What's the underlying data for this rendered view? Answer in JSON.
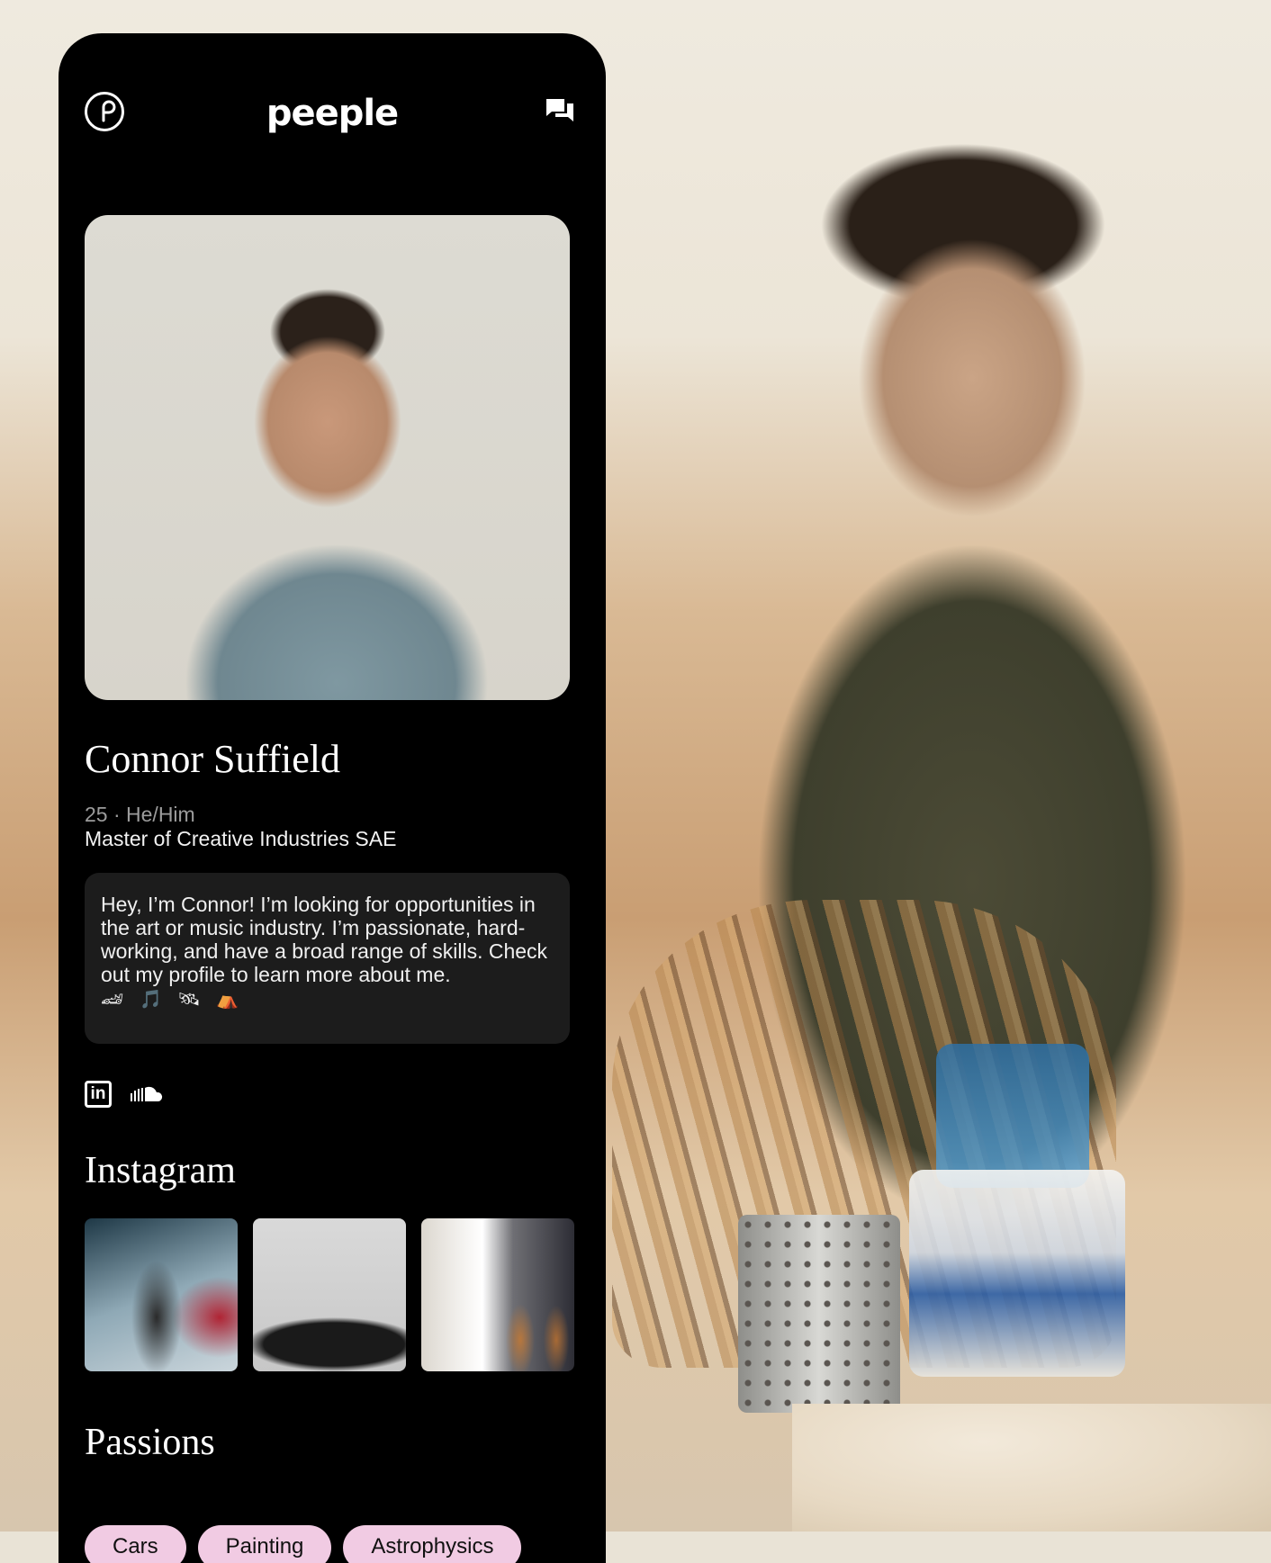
{
  "app": {
    "brand": "peeple"
  },
  "profile": {
    "name": "Connor Suffield",
    "age_pronouns": "25 · He/Him",
    "education": "Master of Creative Industries SAE",
    "bio": "Hey, I’m Connor! I’m looking for opportunities in the art or music industry. I’m passionate, hard-working, and have a broad range of skills. Check out my profile to learn more about me.",
    "bio_emojis": "🏎 🎵 🛰 ⛺",
    "socials": [
      {
        "icon": "linkedin-icon",
        "label": "in"
      },
      {
        "icon": "soundcloud-icon"
      }
    ]
  },
  "instagram": {
    "title": "Instagram",
    "photos": [
      "concert-photo",
      "record-player-photo",
      "guitar-room-photo"
    ]
  },
  "passions": {
    "title": "Passions",
    "items": [
      "Cars",
      "Painting",
      "Astrophysics"
    ]
  },
  "colors": {
    "panel": "#000000",
    "bio_card": "#1c1c1c",
    "chip": "#f1cbe3"
  }
}
